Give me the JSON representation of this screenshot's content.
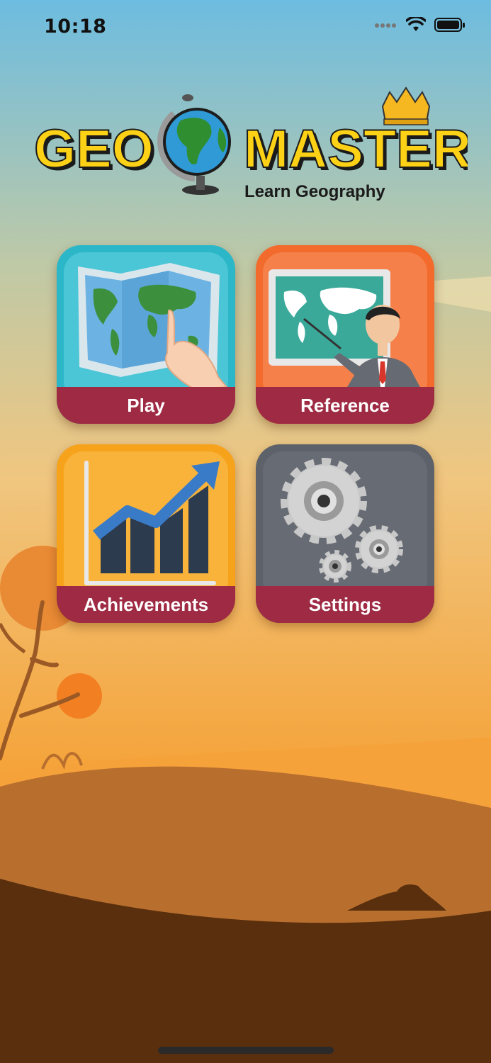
{
  "status": {
    "time": "10:18"
  },
  "logo": {
    "word_left": "GEO",
    "word_right": "MASTER",
    "tagline": "Learn Geography"
  },
  "menu": {
    "play_label": "Play",
    "reference_label": "Reference",
    "achievements_label": "Achievements",
    "settings_label": "Settings"
  },
  "colors": {
    "label_bar": "#9e2a43",
    "play_tile": "#2cb7c9",
    "reference_tile": "#f26a2c",
    "achievements_tile": "#f7a21b",
    "settings_tile": "#5d6169"
  }
}
